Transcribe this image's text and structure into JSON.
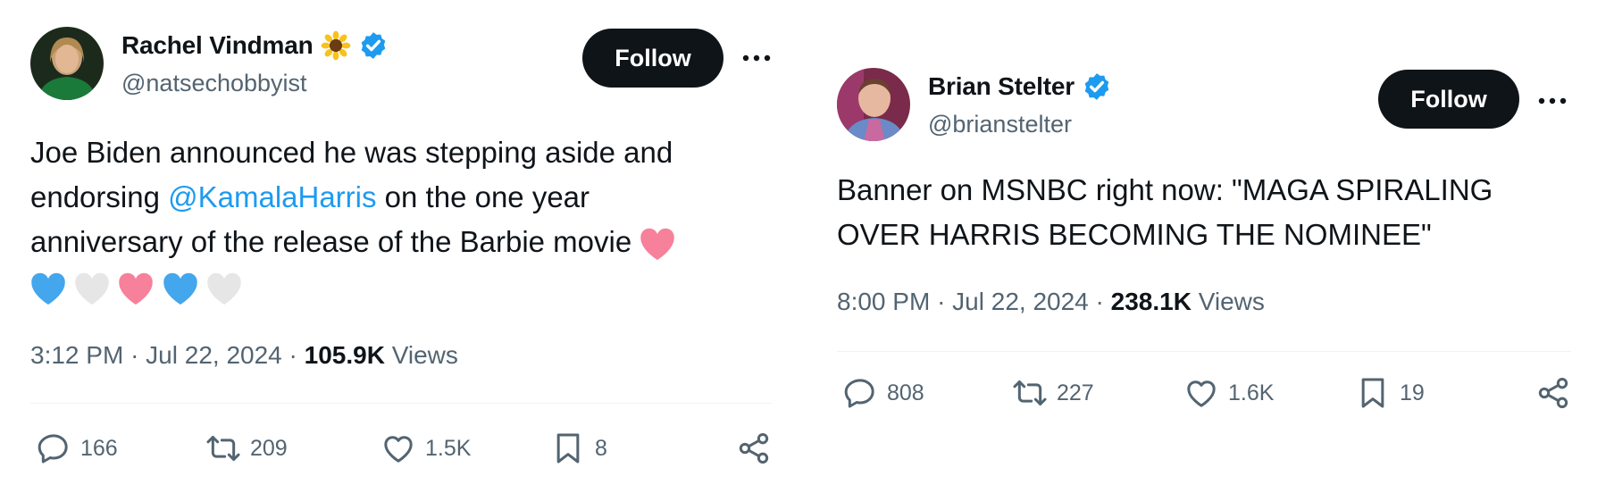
{
  "tweets": [
    {
      "author": {
        "name": "Rachel Vindman",
        "handle": "@natsechobbyist"
      },
      "follow_label": "Follow",
      "body": {
        "before": "Joe Biden announced he was stepping aside and endorsing ",
        "mention": "@KamalaHarris",
        "after": " on the one year anniversary of the release of the Barbie movie"
      },
      "meta": {
        "time": "3:12 PM",
        "sep": "·",
        "date": "Jul 22, 2024",
        "views_count": "105.9K",
        "views_label": "Views"
      },
      "stats": {
        "replies": "166",
        "reposts": "209",
        "likes": "1.5K",
        "bookmarks": "8"
      }
    },
    {
      "author": {
        "name": "Brian Stelter",
        "handle": "@brianstelter"
      },
      "follow_label": "Follow",
      "body": {
        "text": "Banner on MSNBC right now: \"MAGA SPIRALING OVER HARRIS BECOMING THE NOMINEE\""
      },
      "meta": {
        "time": "8:00 PM",
        "sep": "·",
        "date": "Jul 22, 2024",
        "views_count": "238.1K",
        "views_label": "Views"
      },
      "stats": {
        "replies": "808",
        "reposts": "227",
        "likes": "1.6K",
        "bookmarks": "19"
      }
    }
  ],
  "colors": {
    "accent": "#1d9bf0",
    "text": "#0f1419",
    "muted": "#536471",
    "button": "#0f1419",
    "heart_pink": "#f7809a",
    "heart_blue": "#44a6ec",
    "heart_white": "#e6e6e6"
  },
  "icons": [
    "verified-badge-icon",
    "sunflower-icon",
    "more-icon",
    "reply-icon",
    "repost-icon",
    "like-icon",
    "bookmark-icon",
    "share-icon",
    "pink-heart-emoji",
    "blue-heart-emoji",
    "white-heart-emoji"
  ]
}
